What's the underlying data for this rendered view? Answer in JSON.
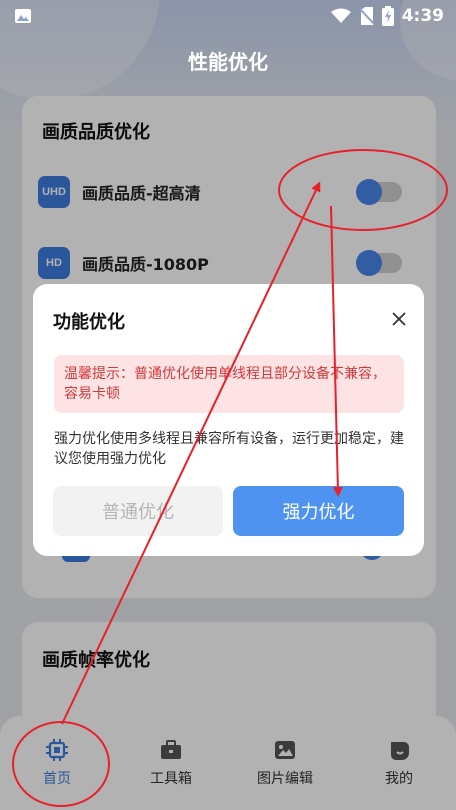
{
  "status_bar": {
    "time": "4:39"
  },
  "header": {
    "title": "性能优化"
  },
  "quality_card": {
    "title": "画质品质优化",
    "items": [
      {
        "badge": "UHD",
        "label": "画质品质-超高清",
        "enabled": false
      },
      {
        "badge": "HD",
        "label": "画质品质-1080P",
        "enabled": false
      }
    ]
  },
  "framerate_card": {
    "title": "画质帧率优化"
  },
  "dialog": {
    "title": "功能优化",
    "warning": "温馨提示：普通优化使用单线程且部分设备不兼容，容易卡顿",
    "description": "强力优化使用多线程且兼容所有设备，运行更加稳定，建议您使用强力优化",
    "normal_button": "普通优化",
    "strong_button": "强力优化"
  },
  "bottom_nav": {
    "items": [
      {
        "label": "首页",
        "icon": "chip-icon",
        "active": true
      },
      {
        "label": "工具箱",
        "icon": "toolbox-icon",
        "active": false
      },
      {
        "label": "图片编辑",
        "icon": "image-icon",
        "active": false
      },
      {
        "label": "我的",
        "icon": "profile-icon",
        "active": false
      }
    ]
  },
  "colors": {
    "accent": "#4f93f0",
    "warning_text": "#d23a3a",
    "annotation": "#e8202a"
  }
}
